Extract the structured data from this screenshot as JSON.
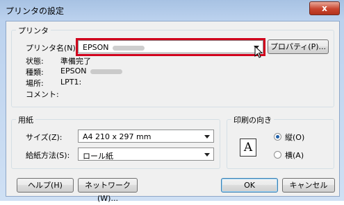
{
  "window": {
    "title": "プリンタの設定",
    "close_label": "x"
  },
  "printer_group": {
    "title": "プリンタ",
    "name_label": "プリンタ名(N):",
    "name_value": "EPSON",
    "properties_button": "プロパティ(P)...",
    "status_label": "状態:",
    "status_value": "準備完了",
    "type_label": "種類:",
    "type_value": "EPSON",
    "location_label": "場所:",
    "location_value": "LPT1:",
    "comment_label": "コメント:"
  },
  "paper_group": {
    "title": "用紙",
    "size_label": "サイズ(Z):",
    "size_value": "A4 210 x 297 mm",
    "source_label": "給紙方法(S):",
    "source_value": "ロール紙"
  },
  "orientation_group": {
    "title": "印刷の向き",
    "icon_letter": "A",
    "portrait_label": "縦(O)",
    "landscape_label": "横(A)",
    "selected": "portrait"
  },
  "buttons": {
    "help": "ヘルプ(H)",
    "network": "ネットワーク(W)...",
    "ok": "OK",
    "cancel": "キャンセル"
  }
}
